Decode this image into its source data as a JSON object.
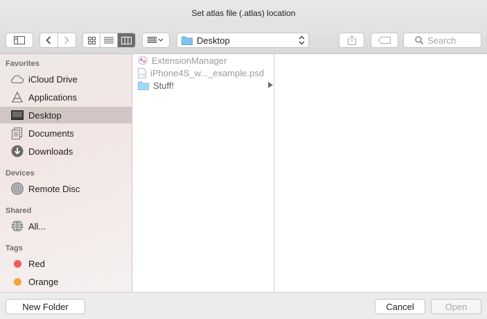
{
  "window": {
    "title": "Set atlas file (.atlas) location"
  },
  "toolbar": {
    "path_label": "Desktop",
    "search_placeholder": "Search"
  },
  "sidebar": {
    "favorites_header": "Favorites",
    "favorites": [
      {
        "label": "iCloud Drive",
        "icon": "cloud-icon"
      },
      {
        "label": "Applications",
        "icon": "applications-icon"
      },
      {
        "label": "Desktop",
        "icon": "desktop-icon",
        "selected": true
      },
      {
        "label": "Documents",
        "icon": "documents-icon"
      },
      {
        "label": "Downloads",
        "icon": "downloads-icon"
      }
    ],
    "devices_header": "Devices",
    "devices": [
      {
        "label": "Remote Disc",
        "icon": "disc-icon"
      }
    ],
    "shared_header": "Shared",
    "shared": [
      {
        "label": "All...",
        "icon": "network-icon"
      }
    ],
    "tags_header": "Tags",
    "tags": [
      {
        "label": "Red",
        "color": "#f25a57"
      },
      {
        "label": "Orange",
        "color": "#f6a33a"
      }
    ]
  },
  "files": [
    {
      "name": "ExtensionManager",
      "type": "app",
      "enabled": false
    },
    {
      "name": "iPhone4S_w..._example.psd",
      "type": "psd",
      "enabled": false
    },
    {
      "name": "Stuff!",
      "type": "folder",
      "enabled": true
    }
  ],
  "footer": {
    "new_folder_label": "New Folder",
    "cancel_label": "Cancel",
    "open_label": "Open"
  }
}
